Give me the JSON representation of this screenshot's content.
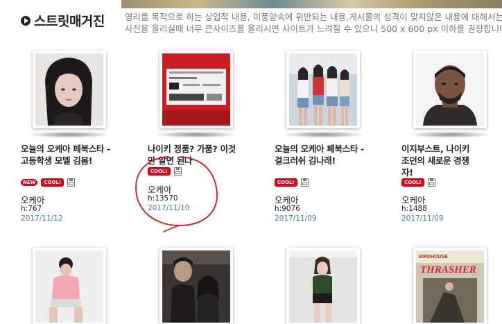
{
  "section": {
    "title": "스트릿매거진",
    "notice_line1": "영리를 목적으로 하는 상업적 내용, 미풍양속에 위반되는 내용,게시물의 성격이 맞지않은 내용에 대해서는 임의로 삭",
    "notice_line2": "사진을 올리실때 너무 큰사이즈를 올리시면 사이트가 느려질 수 있으니 500 x 600 px 이하를 권장합니다."
  },
  "badges": {
    "new": "NEW",
    "cool": "COOL!"
  },
  "posts": [
    {
      "title": "오늘의 오케아 페북스타 - 고등학생 모델 김봄!",
      "is_new": true,
      "is_cool": true,
      "author": "오케아",
      "hits": "h:767",
      "date": "2017/11/12"
    },
    {
      "title": "나이키 정품? 가품? 이것만 알면 된다",
      "is_new": false,
      "is_cool": true,
      "author": "오케아",
      "hits": "h:13570",
      "date": "2017/11/10"
    },
    {
      "title": "오늘의 오케아 페북스타 - 걸크러쉬 김나래!",
      "is_new": false,
      "is_cool": true,
      "author": "오케아",
      "hits": "h:9076",
      "date": "2017/11/09"
    },
    {
      "title": "이지부스트, 나이키 조던의 새로운 경쟁자!",
      "is_new": false,
      "is_cool": true,
      "author": "오케아",
      "hits": "h:1488",
      "date": "2017/11/09"
    }
  ],
  "row2": [
    {
      "thumb": "photo"
    },
    {
      "thumb": "photo"
    },
    {
      "thumb": "photo"
    },
    {
      "thumb": "magazine",
      "mag_text1": "BIRDHOUSE",
      "mag_text2": "THRASHER"
    }
  ],
  "colors": {
    "badge_red": "#e8001c",
    "date_blue": "#3b79c6",
    "annotation_red": "#e0101c"
  },
  "icons": [
    "play-circle-icon",
    "save-icon"
  ]
}
